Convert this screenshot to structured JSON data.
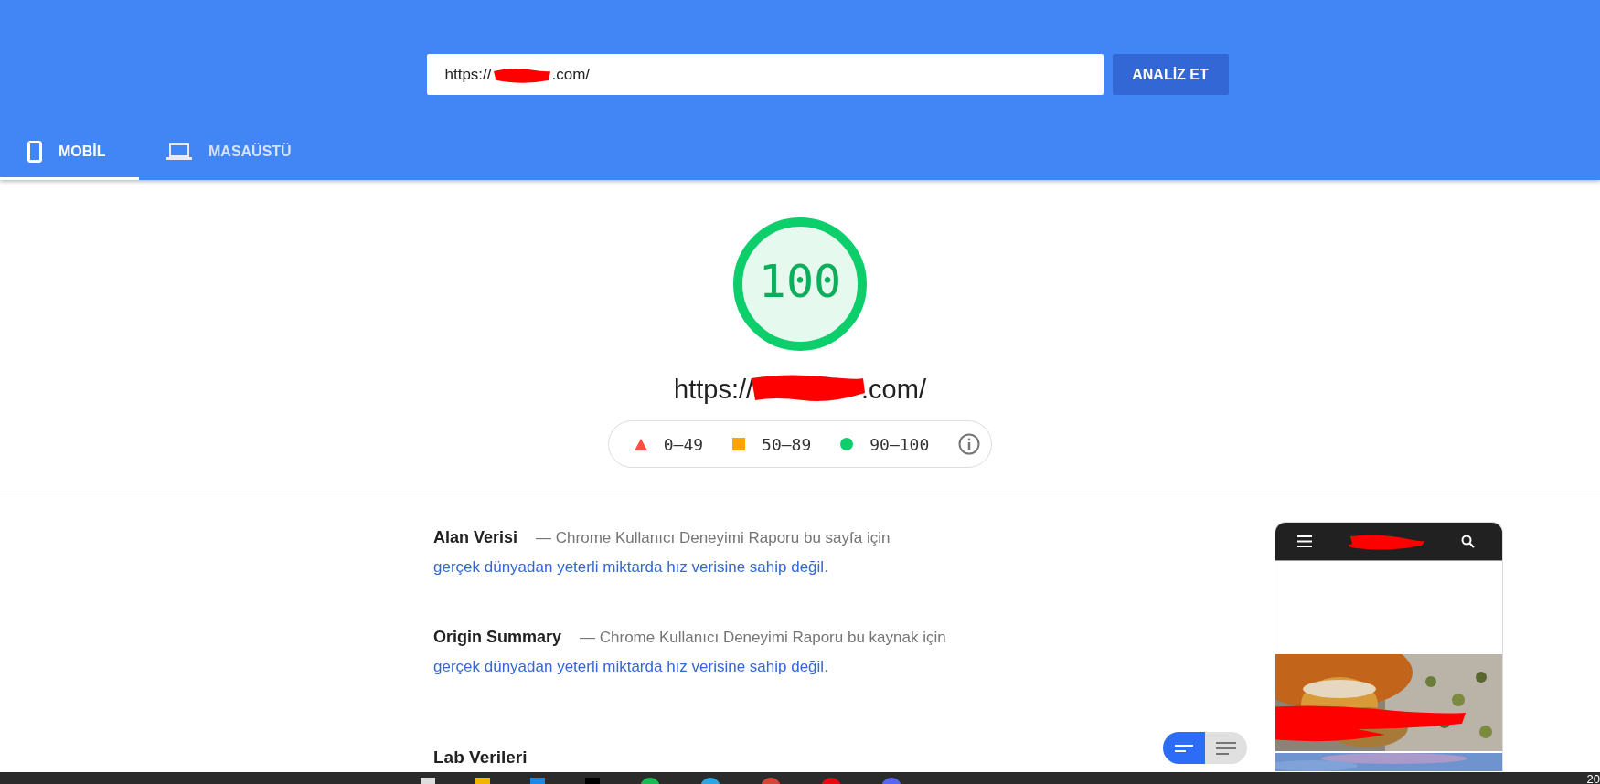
{
  "url_field": {
    "value_start": "https://",
    "value_end": ".com/"
  },
  "analyze_button": "ANALİZ ET",
  "tabs": [
    {
      "label": "MOBİL",
      "kind": "mobile",
      "selected": true
    },
    {
      "label": "MASAÜSTÜ",
      "kind": "desktop",
      "selected": false
    }
  ],
  "score": {
    "value": "100",
    "level": 1
  },
  "tested_url": {
    "start": "https://",
    "end": ".com/"
  },
  "legend": [
    {
      "kind": "triangle",
      "range": "0–49",
      "color": "#ff4e42"
    },
    {
      "kind": "square",
      "range": "50–89",
      "color": "#ffa400"
    },
    {
      "kind": "circle",
      "range": "90–100",
      "color": "#0cce6b"
    }
  ],
  "sections": [
    {
      "title": "Alan Verisi",
      "text": "— Chrome Kullanıcı Deneyimi Raporu bu sayfa için",
      "link": "gerçek dünyadan yeterli miktarda hız verisine sahip değil",
      "end": "."
    },
    {
      "title": "Origin Summary",
      "text": "— Chrome Kullanıcı Deneyimi Raporu bu kaynak için",
      "link": "gerçek dünyadan yeterli miktarda hız verisine sahip değil",
      "end": "."
    }
  ],
  "lab_heading": "Lab Verileri",
  "view_toggle": [
    {
      "kind": "short",
      "selected": true
    },
    {
      "kind": "long",
      "selected": false
    }
  ],
  "taskbar": {
    "clock": "20"
  }
}
